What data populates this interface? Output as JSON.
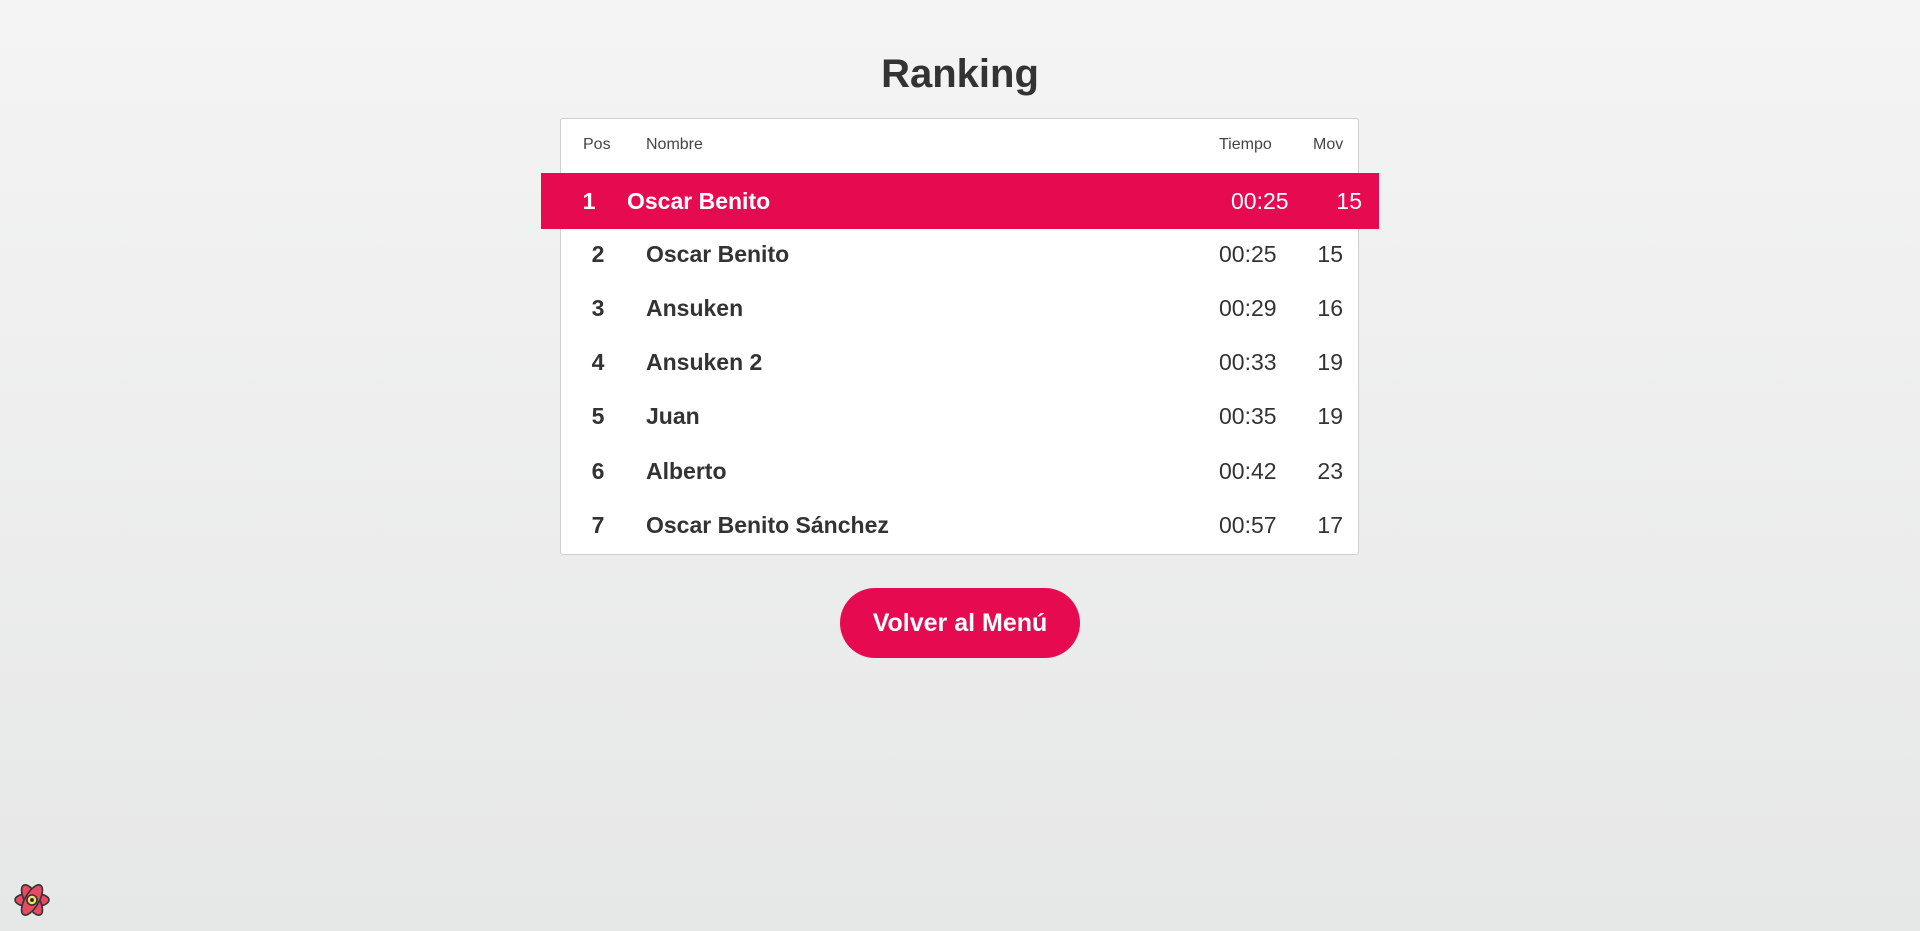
{
  "page": {
    "title": "Ranking"
  },
  "table": {
    "headers": {
      "pos": "Pos",
      "name": "Nombre",
      "time": "Tiempo",
      "mov": "Mov"
    },
    "rows": [
      {
        "pos": "1",
        "name": "Oscar Benito",
        "time": "00:25",
        "mov": "15",
        "highlighted": true
      },
      {
        "pos": "2",
        "name": "Oscar Benito",
        "time": "00:25",
        "mov": "15"
      },
      {
        "pos": "3",
        "name": "Ansuken",
        "time": "00:29",
        "mov": "16"
      },
      {
        "pos": "4",
        "name": "Ansuken 2",
        "time": "00:33",
        "mov": "19"
      },
      {
        "pos": "5",
        "name": "Juan",
        "time": "00:35",
        "mov": "19"
      },
      {
        "pos": "6",
        "name": "Alberto",
        "time": "00:42",
        "mov": "23"
      },
      {
        "pos": "7",
        "name": "Oscar Benito Sánchez",
        "time": "00:57",
        "mov": "17"
      }
    ]
  },
  "actions": {
    "back_label": "Volver al Menú"
  },
  "colors": {
    "accent": "#e60b51",
    "text": "#333333",
    "background": "#efefef"
  },
  "icons": {
    "devtools": "react-icon"
  }
}
